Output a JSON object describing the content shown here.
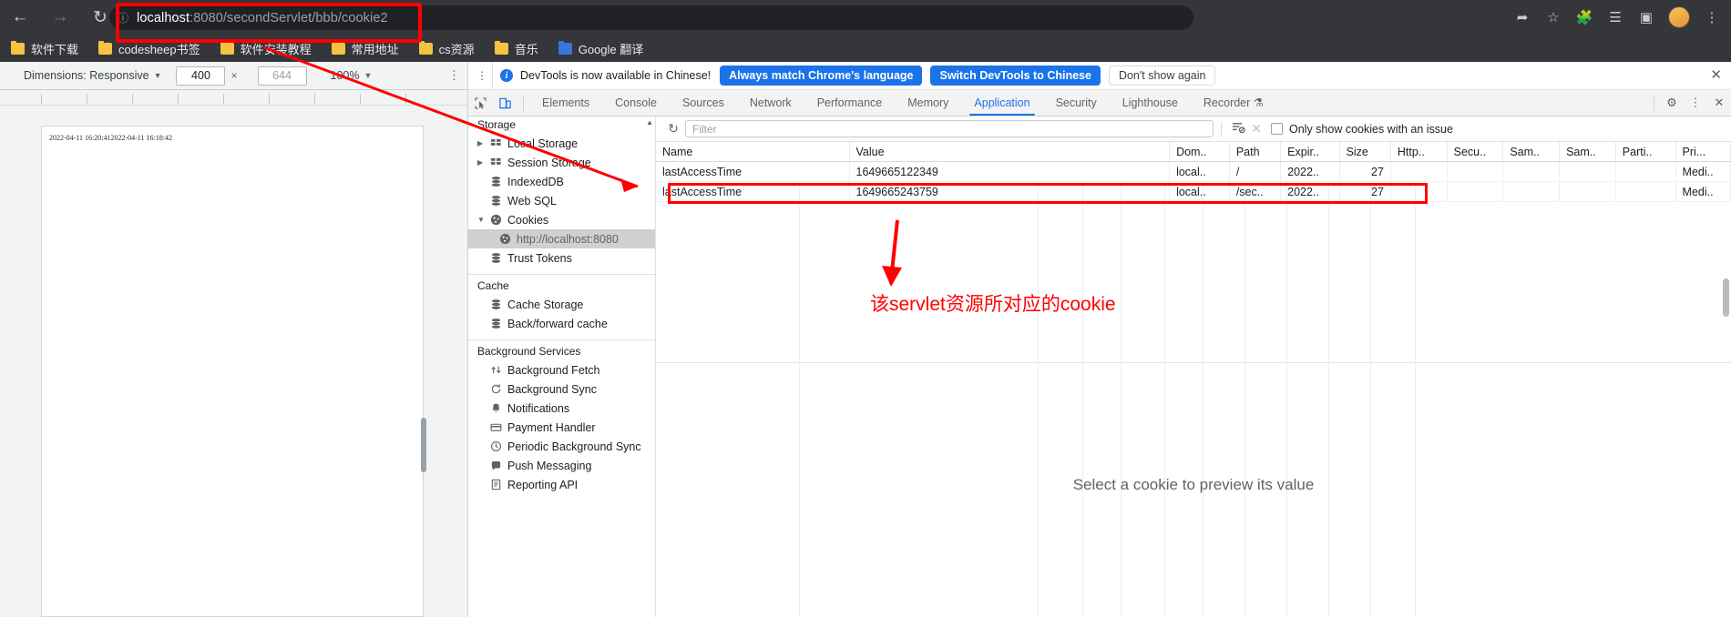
{
  "browser": {
    "nav": {
      "back_icon": "arrow-left-icon",
      "forward_icon": "arrow-right-icon",
      "reload_icon": "reload-icon"
    },
    "omnibox": {
      "info_icon": "site-info-icon",
      "url_host": "localhost",
      "url_rest": ":8080/secondServlet/bbb/cookie2",
      "full_url": "localhost:8080/secondServlet/bbb/cookie2"
    },
    "top_right_icons": [
      "share-icon",
      "bookmark-star-icon",
      "extensions-puzzle-icon",
      "reading-list-icon",
      "sidebar-panel-icon",
      "profile-avatar",
      "kebab-menu-icon"
    ],
    "bookmarks": [
      {
        "label": "软件下载",
        "icon": "folder-icon"
      },
      {
        "label": "codesheep书签",
        "icon": "folder-icon"
      },
      {
        "label": "软件安装教程",
        "icon": "folder-icon"
      },
      {
        "label": "常用地址",
        "icon": "folder-icon"
      },
      {
        "label": "cs资源",
        "icon": "folder-icon"
      },
      {
        "label": "音乐",
        "icon": "folder-icon"
      },
      {
        "label": "Google 翻译",
        "icon": "google-translate-icon"
      }
    ]
  },
  "device_toolbar": {
    "dimensions_label": "Dimensions: Responsive",
    "caret": "▼",
    "width_value": "400",
    "x_sign": "×",
    "height_value": "644",
    "zoom_label": "100%",
    "more_icon": "kebab-menu-icon"
  },
  "page_preview": {
    "content_text": "2022-04-11  16:20:412022-04-11  16:18:42"
  },
  "notification": {
    "kebab_icon": "kebab-menu-icon",
    "info_icon": "info-icon",
    "message": "DevTools is now available in Chinese!",
    "primary_button": "Always match Chrome's language",
    "secondary_button": "Switch DevTools to Chinese",
    "dismiss_button": "Don't show again",
    "close_icon": "close-icon"
  },
  "devtools": {
    "inspect_icon": "inspect-cursor-icon",
    "device_toggle_icon": "device-toolbar-icon",
    "tabs": [
      {
        "label": "Elements",
        "active": false
      },
      {
        "label": "Console",
        "active": false
      },
      {
        "label": "Sources",
        "active": false
      },
      {
        "label": "Network",
        "active": false
      },
      {
        "label": "Performance",
        "active": false
      },
      {
        "label": "Memory",
        "active": false
      },
      {
        "label": "Application",
        "active": true
      },
      {
        "label": "Security",
        "active": false
      },
      {
        "label": "Lighthouse",
        "active": false
      },
      {
        "label": "Recorder",
        "active": false
      }
    ],
    "recorder_badge_icon": "recorder-flask-icon",
    "right_icons": [
      "settings-gear-icon",
      "kebab-menu-icon",
      "close-icon"
    ]
  },
  "sidebar": {
    "scroll_up_icon": "chevron-up-icon",
    "storage_section": {
      "title": "Storage",
      "items": [
        {
          "label": "Local Storage",
          "icon": "table-icon",
          "twisty": "▶",
          "selected": false
        },
        {
          "label": "Session Storage",
          "icon": "table-icon",
          "twisty": "▶",
          "selected": false
        },
        {
          "label": "IndexedDB",
          "icon": "database-icon",
          "twisty": "",
          "selected": false
        },
        {
          "label": "Web SQL",
          "icon": "database-icon",
          "twisty": "",
          "selected": false
        },
        {
          "label": "Cookies",
          "icon": "cookie-icon",
          "twisty": "▼",
          "selected": false
        },
        {
          "label": "http://localhost:8080",
          "icon": "cookie-icon",
          "twisty": "",
          "selected": true,
          "child": true
        },
        {
          "label": "Trust Tokens",
          "icon": "database-icon",
          "twisty": "",
          "selected": false
        }
      ]
    },
    "cache_section": {
      "title": "Cache",
      "items": [
        {
          "label": "Cache Storage",
          "icon": "database-icon"
        },
        {
          "label": "Back/forward cache",
          "icon": "database-icon"
        }
      ]
    },
    "background_section": {
      "title": "Background Services",
      "items": [
        {
          "label": "Background Fetch",
          "icon": "background-fetch-icon"
        },
        {
          "label": "Background Sync",
          "icon": "background-sync-icon"
        },
        {
          "label": "Notifications",
          "icon": "bell-icon"
        },
        {
          "label": "Payment Handler",
          "icon": "payment-icon"
        },
        {
          "label": "Periodic Background Sync",
          "icon": "periodic-sync-icon"
        },
        {
          "label": "Push Messaging",
          "icon": "push-messaging-icon"
        },
        {
          "label": "Reporting API",
          "icon": "reporting-api-icon"
        }
      ]
    }
  },
  "cookies_panel": {
    "toolbar": {
      "refresh_icon": "refresh-icon",
      "filter_placeholder": "Filter",
      "filter_value": "",
      "clear_filtered_icon": "filter-clear-icon",
      "clear_all_icon": "clear-all-x-icon",
      "issues_checkbox_label": "Only show cookies with an issue",
      "issues_checkbox_checked": false
    },
    "columns": [
      "Name",
      "Value",
      "Dom..",
      "Path",
      "Expir..",
      "Size",
      "Http..",
      "Secu..",
      "Sam..",
      "Sam..",
      "Parti..",
      "Pri..."
    ],
    "rows": [
      {
        "name": "lastAccessTime",
        "value": "1649665122349",
        "domain": "local..",
        "path": "/",
        "expires": "2022..",
        "size": "27",
        "httponly": "",
        "secure": "",
        "samesite": "",
        "samesite2": "",
        "partitioned": "",
        "priority": "Medi..",
        "highlighted": false
      },
      {
        "name": "lastAccessTime",
        "value": "1649665243759",
        "domain": "local..",
        "path": "/sec..",
        "expires": "2022..",
        "size": "27",
        "httponly": "",
        "secure": "",
        "samesite": "",
        "samesite2": "",
        "partitioned": "",
        "priority": "Medi..",
        "highlighted": true
      }
    ],
    "preview_message": "Select a cookie to preview its value"
  },
  "annotations": {
    "note_text": "该servlet资源所对应的cookie",
    "accent_color": "#ff0000"
  }
}
